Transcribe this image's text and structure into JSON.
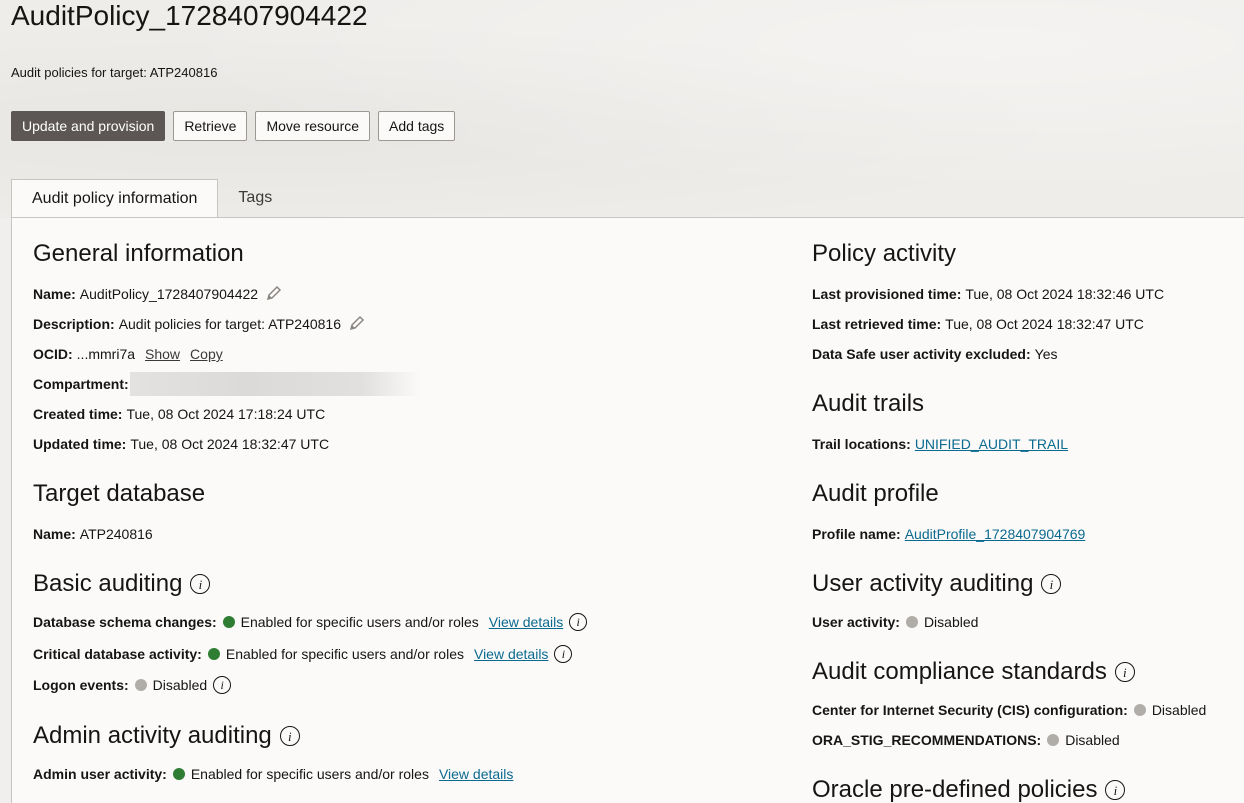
{
  "header": {
    "title": "AuditPolicy_1728407904422",
    "subtitle": "Audit policies for target: ATP240816"
  },
  "toolbar": {
    "update_label": "Update and provision",
    "retrieve_label": "Retrieve",
    "move_label": "Move resource",
    "tags_label": "Add tags"
  },
  "tabs": [
    {
      "label": "Audit policy information",
      "active": true
    },
    {
      "label": "Tags",
      "active": false
    }
  ],
  "general": {
    "title": "General information",
    "name_label": "Name:",
    "name_value": "AuditPolicy_1728407904422",
    "desc_label": "Description:",
    "desc_value": "Audit policies for target: ATP240816",
    "ocid_label": "OCID:",
    "ocid_value": "...mmri7a",
    "show_link": "Show",
    "copy_link": "Copy",
    "compartment_label": "Compartment:",
    "created_label": "Created time:",
    "created_value": "Tue, 08 Oct 2024 17:18:24 UTC",
    "updated_label": "Updated time:",
    "updated_value": "Tue, 08 Oct 2024 18:32:47 UTC"
  },
  "target": {
    "title": "Target database",
    "name_label": "Name:",
    "name_value": "ATP240816"
  },
  "basic": {
    "title": "Basic auditing",
    "schema_label": "Database schema changes:",
    "schema_value": "Enabled for specific users and/or roles",
    "critical_label": "Critical database activity:",
    "critical_value": "Enabled for specific users and/or roles",
    "logon_label": "Logon events:",
    "logon_value": "Disabled",
    "view_details": "View details"
  },
  "admin": {
    "title": "Admin activity auditing",
    "user_label": "Admin user activity:",
    "user_value": "Enabled for specific users and/or roles",
    "view_details": "View details"
  },
  "policy_activity": {
    "title": "Policy activity",
    "provisioned_label": "Last provisioned time:",
    "provisioned_value": "Tue, 08 Oct 2024 18:32:46 UTC",
    "retrieved_label": "Last retrieved time:",
    "retrieved_value": "Tue, 08 Oct 2024 18:32:47 UTC",
    "excluded_label": "Data Safe user activity excluded:",
    "excluded_value": "Yes"
  },
  "trails": {
    "title": "Audit trails",
    "locations_label": "Trail locations:",
    "locations_value": "UNIFIED_AUDIT_TRAIL"
  },
  "profile": {
    "title": "Audit profile",
    "name_label": "Profile name:",
    "name_value": "AuditProfile_1728407904769"
  },
  "user_activity": {
    "title": "User activity auditing",
    "label": "User activity:",
    "value": "Disabled"
  },
  "compliance": {
    "title": "Audit compliance standards",
    "cis_label": "Center for Internet Security (CIS) configuration:",
    "cis_value": "Disabled",
    "stig_label": "ORA_STIG_RECOMMENDATIONS:",
    "stig_value": "Disabled"
  },
  "predefined": {
    "title": "Oracle pre-defined policies"
  },
  "colors": {
    "enabled": "#2e7d32",
    "disabled": "#b0aca8",
    "link": "#0b6a8f",
    "primary_button": "#5c5754"
  },
  "icons": {
    "edit": "pencil-icon",
    "info": "info-icon",
    "status": "status-dot"
  }
}
